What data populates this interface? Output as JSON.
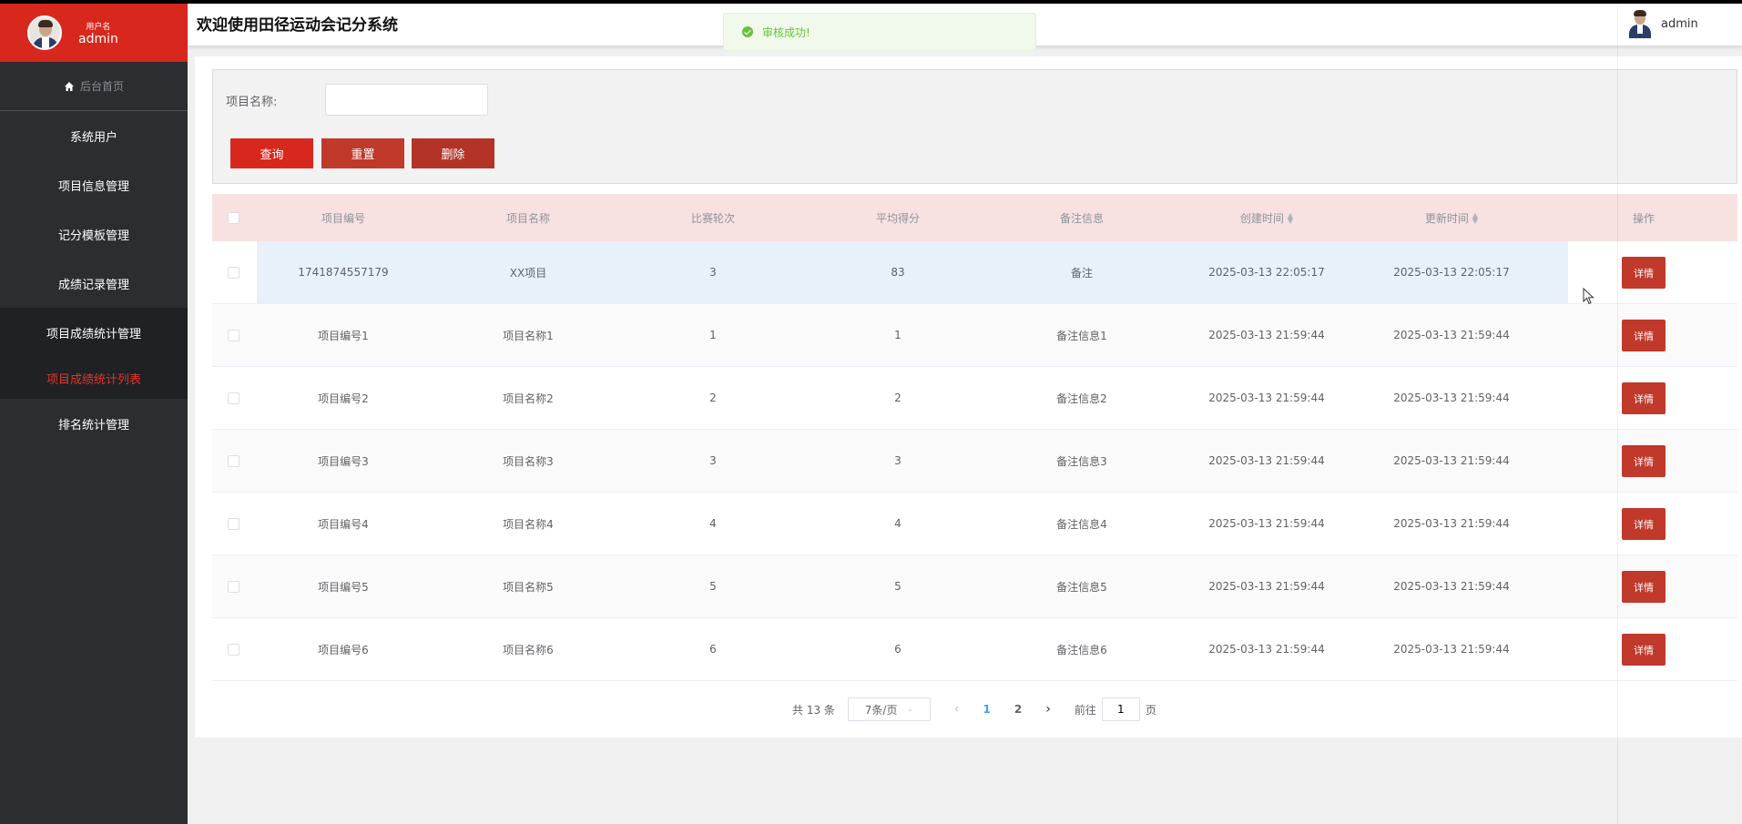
{
  "user": {
    "label": "用户名",
    "name": "admin"
  },
  "nav": {
    "home": "后台首页",
    "items": [
      "系统用户",
      "项目信息管理",
      "记分模板管理",
      "成绩记录管理",
      "项目成绩统计管理"
    ],
    "sub_active": "项目成绩统计列表",
    "last": "排名统计管理"
  },
  "header": {
    "title": "欢迎使用田径运动会记分系统",
    "user": "admin"
  },
  "toast": {
    "text": "审核成功!"
  },
  "search": {
    "label": "项目名称:",
    "value": "",
    "placeholder": ""
  },
  "buttons": {
    "query": "查询",
    "reset": "重置",
    "delete": "删除",
    "detail": "详情"
  },
  "table": {
    "headers": [
      "项目编号",
      "项目名称",
      "比赛轮次",
      "平均得分",
      "备注信息",
      "创建时间",
      "更新时间",
      "操作"
    ],
    "rows": [
      [
        "1741874557179",
        "XX项目",
        "3",
        "83",
        "备注",
        "2025-03-13 22:05:17",
        "2025-03-13 22:05:17"
      ],
      [
        "项目编号1",
        "项目名称1",
        "1",
        "1",
        "备注信息1",
        "2025-03-13 21:59:44",
        "2025-03-13 21:59:44"
      ],
      [
        "项目编号2",
        "项目名称2",
        "2",
        "2",
        "备注信息2",
        "2025-03-13 21:59:44",
        "2025-03-13 21:59:44"
      ],
      [
        "项目编号3",
        "项目名称3",
        "3",
        "3",
        "备注信息3",
        "2025-03-13 21:59:44",
        "2025-03-13 21:59:44"
      ],
      [
        "项目编号4",
        "项目名称4",
        "4",
        "4",
        "备注信息4",
        "2025-03-13 21:59:44",
        "2025-03-13 21:59:44"
      ],
      [
        "项目编号5",
        "项目名称5",
        "5",
        "5",
        "备注信息5",
        "2025-03-13 21:59:44",
        "2025-03-13 21:59:44"
      ],
      [
        "项目编号6",
        "项目名称6",
        "6",
        "6",
        "备注信息6",
        "2025-03-13 21:59:44",
        "2025-03-13 21:59:44"
      ]
    ]
  },
  "pager": {
    "total": "共 13 条",
    "page_size": "7条/页",
    "pages": [
      "1",
      "2"
    ],
    "current": "1",
    "goto_label": "前往",
    "goto_value": "1",
    "page_suffix": "页"
  },
  "colors": {
    "brand": "#d8281d",
    "sidebar": "#2b2d31",
    "header_row": "#f7e1e1",
    "toast": "#67c23a"
  }
}
